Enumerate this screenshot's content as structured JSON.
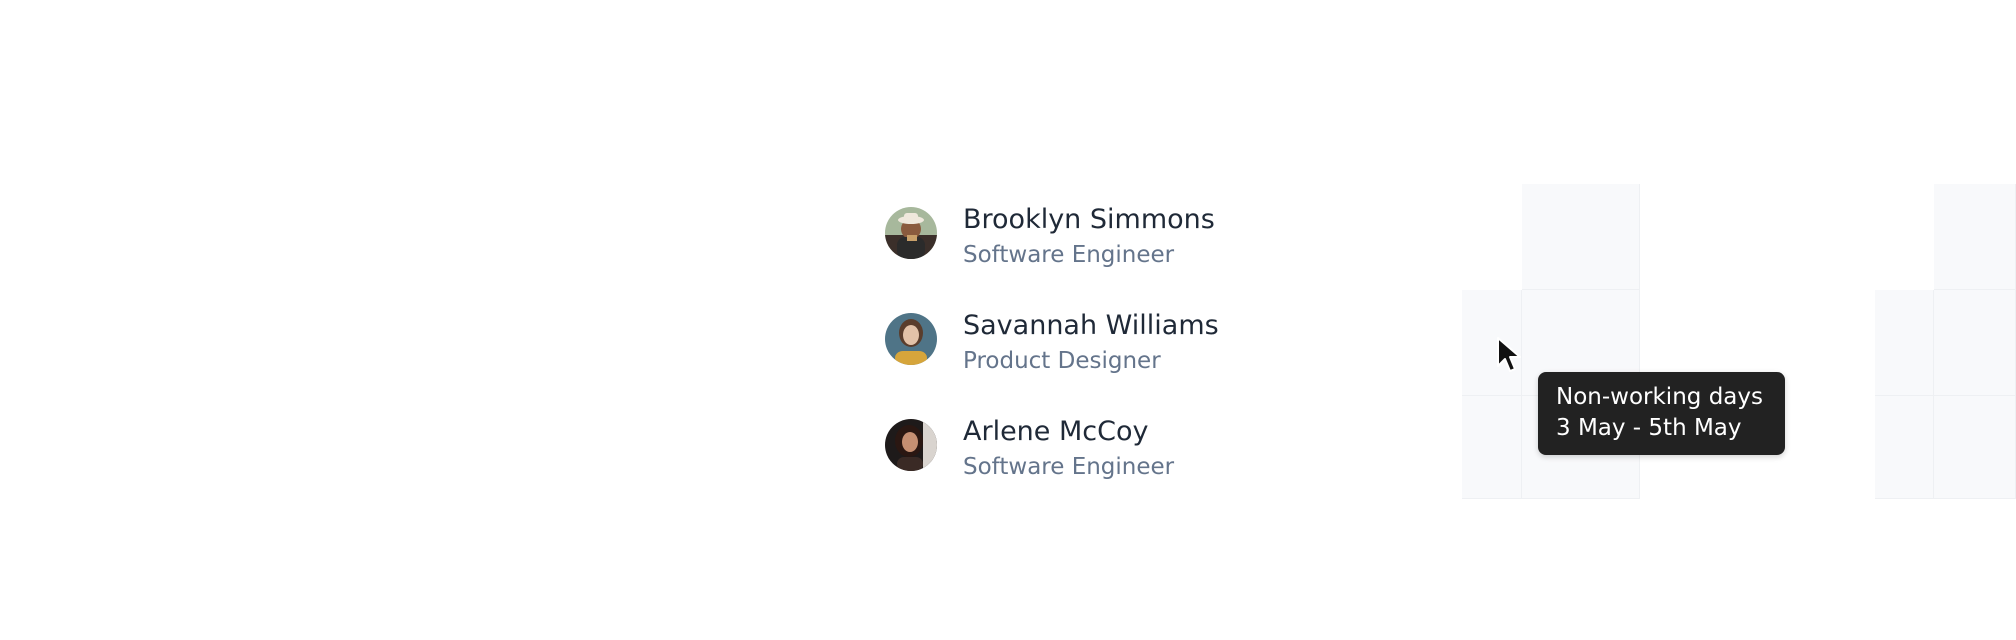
{
  "people": [
    {
      "name": "Brooklyn Simmons",
      "role": "Software Engineer",
      "avatar": "avatar-photo"
    },
    {
      "name": "Savannah Williams",
      "role": "Product Designer",
      "avatar": "avatar-photo"
    },
    {
      "name": "Arlene McCoy",
      "role": "Software Engineer",
      "avatar": "avatar-photo"
    }
  ],
  "tooltip": {
    "title": "Non-working days",
    "dates": "3 May - 5th May"
  },
  "colors": {
    "name_text": "#1f2937",
    "role_text": "#64748b",
    "non_working_cell": "#f8f9fb",
    "tooltip_bg": "#222222",
    "tooltip_text": "#ffffff"
  },
  "icons": {
    "cursor": "mouse-pointer-icon"
  }
}
